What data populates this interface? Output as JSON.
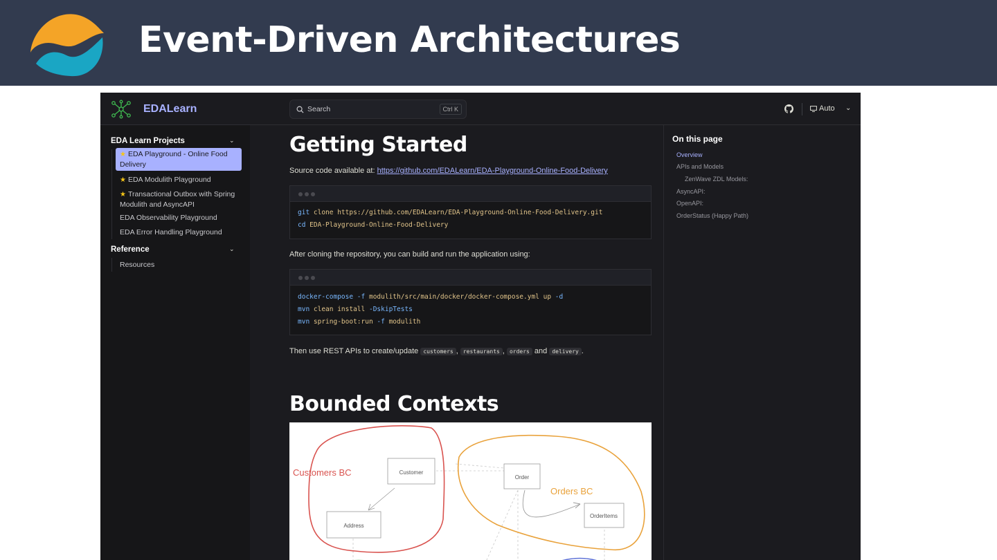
{
  "slide": {
    "title": "Event-Driven Architectures",
    "colors": {
      "banner": "#323b4f",
      "logo_orange": "#f4a427",
      "logo_teal": "#1aa6c4"
    }
  },
  "topnav": {
    "brand": "EDALearn",
    "search_label": "Search",
    "search_shortcut": "Ctrl K",
    "theme_label": "Auto",
    "icons": [
      "network-logo-icon",
      "search-icon",
      "github-icon",
      "monitor-icon",
      "chevron-down-icon"
    ]
  },
  "sidebar": {
    "groups": [
      {
        "title": "EDA Learn Projects",
        "items": [
          {
            "label": "EDA Playground - Online Food Delivery",
            "starred": true,
            "active": true
          },
          {
            "label": "EDA Modulith Playground",
            "starred": true,
            "active": false
          },
          {
            "label": "Transactional Outbox with Spring Modulith and AsyncAPI",
            "starred": true,
            "active": false
          },
          {
            "label": "EDA Observability Playground",
            "starred": false,
            "active": false
          },
          {
            "label": "EDA Error Handling Playground",
            "starred": false,
            "active": false
          }
        ]
      },
      {
        "title": "Reference",
        "items": [
          {
            "label": "Resources",
            "starred": false,
            "active": false
          }
        ]
      }
    ]
  },
  "main": {
    "heading1": "Getting Started",
    "source_prefix": "Source code available at: ",
    "source_link": "https://github.com/EDALearn/EDA-Playground-Online-Food-Delivery",
    "code1": {
      "line1_cmd": "git",
      "line1_rest": " clone https://github.com/EDALearn/EDA-Playground-Online-Food-Delivery.git",
      "line2_cmd": "cd",
      "line2_rest": " EDA-Playground-Online-Food-Delivery"
    },
    "after_clone": "After cloning the repository, you can build and run the application using:",
    "code2": {
      "line1_cmd": "docker-compose",
      "line1_flag": " -f",
      "line1_mid": " modulith/src/main/docker/docker-compose.yml up",
      "line1_flag2": " -d",
      "line2_cmd": "mvn",
      "line2_mid": " clean install",
      "line2_flag": " -DskipTests",
      "line3_cmd": "mvn",
      "line3_mid": " spring-boot:run",
      "line3_flag": " -f",
      "line3_end": " modulith"
    },
    "rest_prefix": "Then use REST APIs to create/update ",
    "rest_codes": [
      "customers",
      "restaurants",
      "orders",
      "delivery"
    ],
    "rest_sep1": ", ",
    "rest_sep2": ", ",
    "rest_and": " and ",
    "rest_end": ".",
    "heading2": "Bounded Contexts",
    "diagram": {
      "customers_bc": "Customers BC",
      "orders_bc": "Orders BC",
      "boxes": [
        "Customer",
        "Address",
        "Order",
        "OrderItems"
      ],
      "colors": {
        "customers": "#d9534f",
        "orders": "#e9a23b"
      }
    }
  },
  "outline": {
    "title": "On this page",
    "items": [
      "Overview",
      "APIs and Models",
      "ZenWave ZDL Models:",
      "AsyncAPI:",
      "OpenAPI:",
      "OrderStatus (Happy Path)"
    ]
  }
}
